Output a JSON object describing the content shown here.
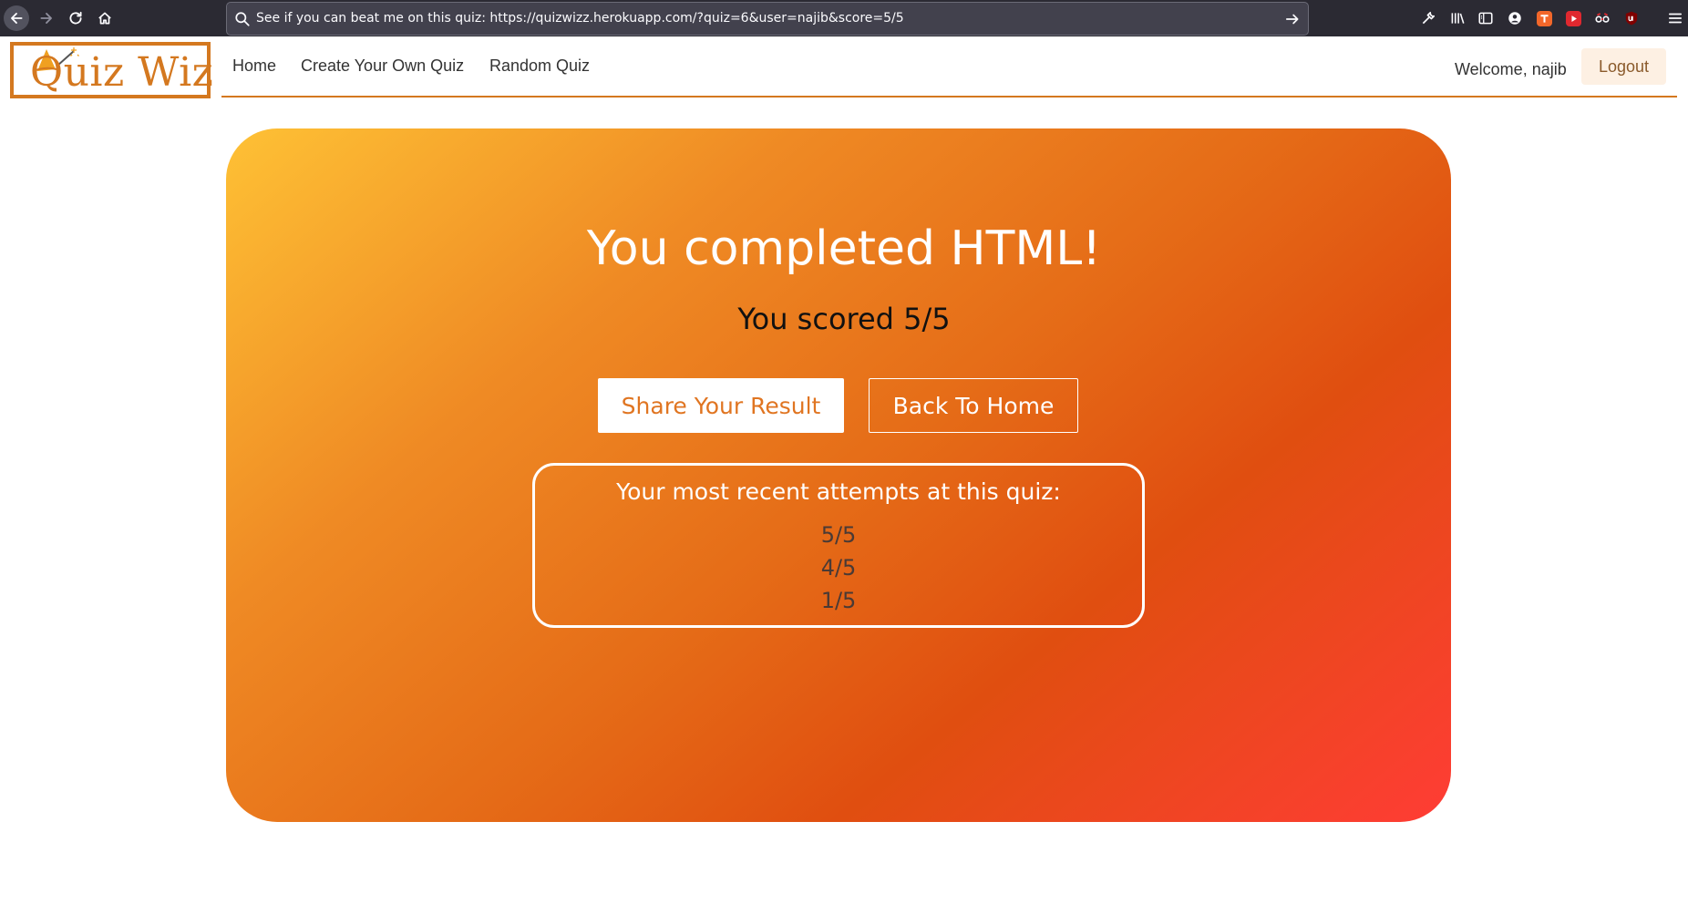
{
  "browser": {
    "url": "See if you can beat me on this quiz: https://quizwizz.herokuapp.com/?quiz=6&user=najib&score=5/5",
    "toolbar_icons": [
      "wrench-icon",
      "library-icon",
      "sidebar-icon",
      "account-icon",
      "extension-t-icon",
      "extension-red-icon",
      "extension-glasses-icon",
      "ublock-icon",
      "menu-icon"
    ]
  },
  "site": {
    "logo_text": "Quiz Wiz",
    "nav": [
      "Home",
      "Create Your Own Quiz",
      "Random Quiz"
    ],
    "welcome": "Welcome, najib",
    "logout_label": "Logout",
    "accent_color": "#d4781f"
  },
  "result": {
    "title": "You completed HTML!",
    "score_text": "You scored 5/5",
    "share_label": "Share Your Result",
    "home_label": "Back To Home",
    "attempts_heading": "Your most recent attempts at this quiz:",
    "attempts": [
      "5/5",
      "4/5",
      "1/5"
    ]
  }
}
